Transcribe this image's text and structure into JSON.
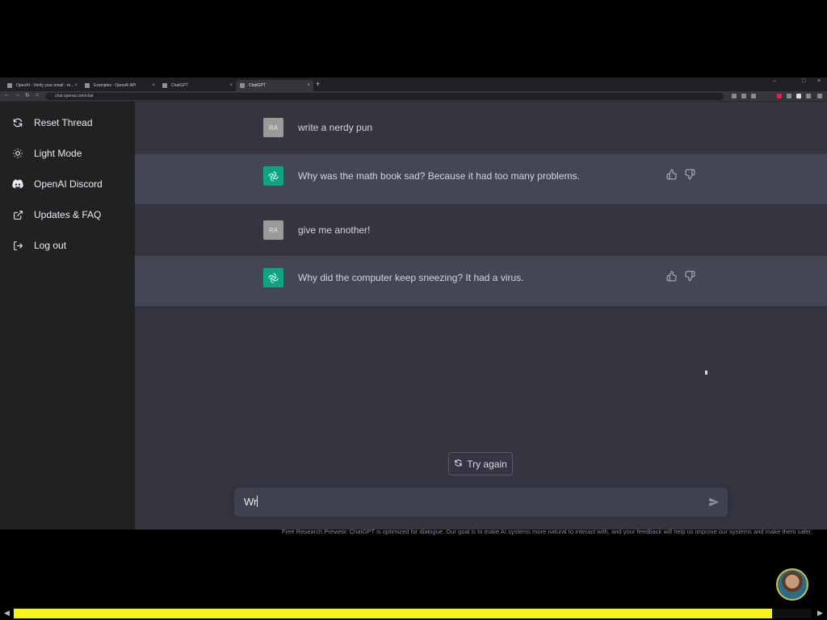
{
  "browser": {
    "tabs": [
      {
        "title": "OpenAI - Verify your email - re...",
        "active": false
      },
      {
        "title": "Examples - OpenAI API",
        "active": false
      },
      {
        "title": "ChatGPT",
        "active": false
      },
      {
        "title": "ChatGPT",
        "active": true
      }
    ],
    "url": "chat.openai.com/chat",
    "window_controls": [
      "–",
      "□",
      "×"
    ],
    "nav_icons": [
      "back-icon",
      "forward-icon",
      "reload-icon",
      "home-icon"
    ]
  },
  "sidebar": {
    "items": [
      {
        "label": "Reset Thread",
        "icon": "reset-icon"
      },
      {
        "label": "Light Mode",
        "icon": "sun-icon"
      },
      {
        "label": "OpenAI Discord",
        "icon": "discord-icon"
      },
      {
        "label": "Updates & FAQ",
        "icon": "external-link-icon"
      },
      {
        "label": "Log out",
        "icon": "logout-icon"
      }
    ]
  },
  "conversation": [
    {
      "role": "user",
      "avatar_text": "RA",
      "text": "write a nerdy pun"
    },
    {
      "role": "assistant",
      "text": "Why was the math book sad? Because it had too many problems."
    },
    {
      "role": "user",
      "avatar_text": "RA",
      "text": "give me another!"
    },
    {
      "role": "assistant",
      "text": "Why did the computer keep sneezing? It had a virus."
    }
  ],
  "try_again_label": "Try again",
  "input": {
    "value": "Wr"
  },
  "footer_note": "Free Research Preview: ChatGPT is optimized for dialogue. Our goal is to make AI systems more natural to interact with, and your feedback will help us improve our systems and make them safer.",
  "video_progress_fraction": 0.95,
  "colors": {
    "sidebar_bg": "#202123",
    "main_bg": "#343541",
    "bot_row_bg": "#444654",
    "accent": "#10a37f",
    "progress": "#f5f51a"
  }
}
